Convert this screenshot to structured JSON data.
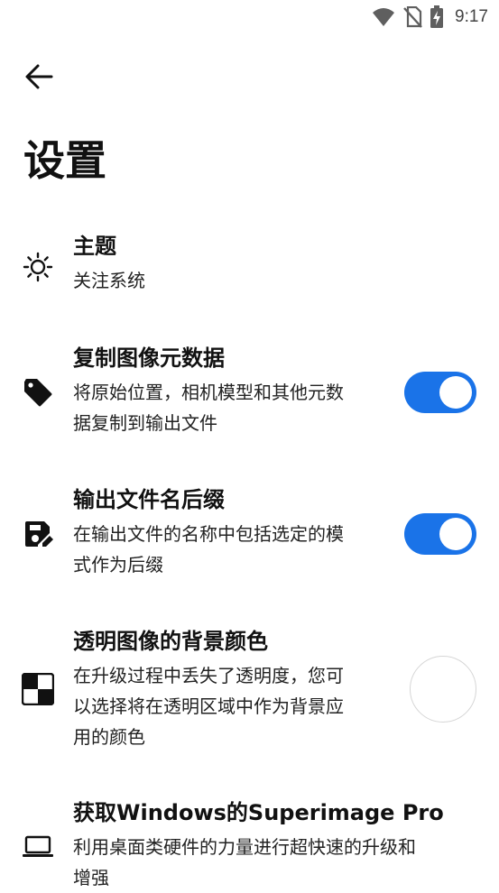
{
  "status_bar": {
    "time": "9:17",
    "icons": [
      "wifi-icon",
      "no-sim-icon",
      "battery-charging-icon"
    ]
  },
  "header": {
    "back_icon": "arrow-back-icon",
    "title": "设置"
  },
  "settings": [
    {
      "id": "theme",
      "icon": "sun-icon",
      "title": "主题",
      "description": "关注系统"
    },
    {
      "id": "copy-metadata",
      "icon": "tag-icon",
      "title": "复制图像元数据",
      "description_lines": [
        "将原始位置，相机模型和其他元数",
        "据复制到输出文件"
      ],
      "toggle_on": true
    },
    {
      "id": "output-suffix",
      "icon": "save-edit-icon",
      "title": "输出文件名后缀",
      "description_lines": [
        "在输出文件的名称中包括选定的模",
        "式作为后缀"
      ],
      "toggle_on": true
    },
    {
      "id": "transparent-bg",
      "icon": "checkerboard-icon",
      "title": "透明图像的背景颜色",
      "description_lines": [
        "在升级过程中丢失了透明度，您可",
        "以选择将在透明区域中作为背景应",
        "用的颜色"
      ],
      "swatch_color": "#ffffff"
    },
    {
      "id": "get-pro",
      "icon": "laptop-icon",
      "title": "获取Windows的Superimage Pro",
      "description_lines": [
        "利用桌面类硬件的力量进行超快速的升级和",
        "增强"
      ]
    }
  ],
  "colors": {
    "accent": "#1a73e8",
    "text": "#111111",
    "background": "#ffffff"
  }
}
